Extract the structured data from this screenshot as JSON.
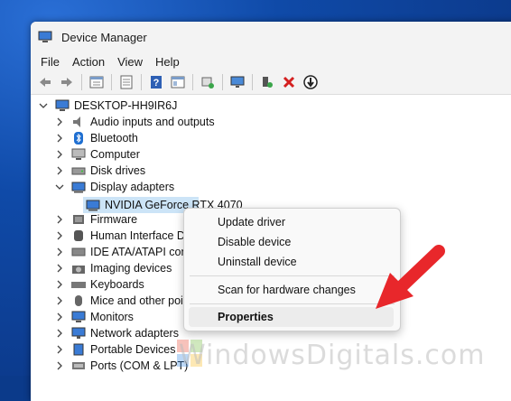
{
  "window": {
    "title": "Device Manager"
  },
  "menu": [
    "File",
    "Action",
    "View",
    "Help"
  ],
  "toolbar": {
    "icons": [
      "back-arrow-icon",
      "forward-arrow-icon",
      "properties-icon",
      "show-hide-icon",
      "help-icon",
      "console-icon",
      "update-driver-icon",
      "monitor-icon",
      "add-hardware-icon",
      "remove-icon",
      "download-icon"
    ]
  },
  "tree": {
    "root": "DESKTOP-HH9IR6J",
    "items": [
      "Audio inputs and outputs",
      "Bluetooth",
      "Computer",
      "Disk drives",
      "Display adapters",
      "NVIDIA GeForce RTX 4070",
      "Firmware",
      "Human Interface De",
      "IDE ATA/ATAPI contr",
      "Imaging devices",
      "Keyboards",
      "Mice and other poin",
      "Monitors",
      "Network adapters",
      "Portable Devices",
      "Ports (COM & LPT)"
    ]
  },
  "context_menu": {
    "items": [
      "Update driver",
      "Disable device",
      "Uninstall device",
      "Scan for hardware changes",
      "Properties"
    ]
  },
  "watermark": {
    "text": "WindowsDigitals.com"
  },
  "colors": {
    "accent_arrow": "#e8272b",
    "selection": "#cce4f7",
    "desktop": "#0b3a8a"
  }
}
